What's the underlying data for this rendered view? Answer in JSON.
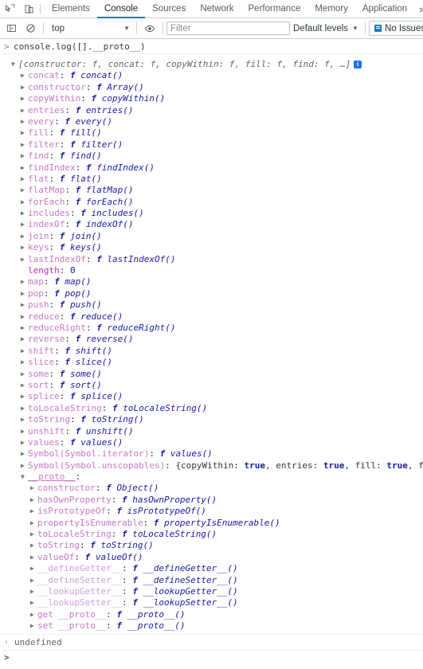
{
  "tabbar": {
    "icons": [
      {
        "name": "inspect-element-icon",
        "glyph": "inspect"
      },
      {
        "name": "device-toolbar-icon",
        "glyph": "device"
      }
    ],
    "tabs": [
      {
        "label": "Elements",
        "active": false
      },
      {
        "label": "Console",
        "active": true
      },
      {
        "label": "Sources",
        "active": false
      },
      {
        "label": "Network",
        "active": false
      },
      {
        "label": "Performance",
        "active": false
      },
      {
        "label": "Memory",
        "active": false
      },
      {
        "label": "Application",
        "active": false
      }
    ],
    "overflow_label": "»",
    "active_accent": "#1a73e8"
  },
  "toolbar": {
    "sidebar_toggle_name": "console-sidebar-toggle",
    "clear_console_name": "clear-console-icon",
    "context_value": "top",
    "context_caret": "▼",
    "eye_icon_name": "live-expression-eye-icon",
    "filter_placeholder": "Filter",
    "filter_value": "",
    "levels_label": "Default levels",
    "levels_caret": "▼",
    "issues_label": "No Issues",
    "issues_accent": "#1a73e8"
  },
  "console": {
    "command": "console.log([].__proto__)",
    "prompt_glyph": ">",
    "return_glyph": "‹",
    "return_value": "undefined",
    "preview_header": "[constructor: f, concat: f, copyWithin: f, fill: f, find: f, …]",
    "info_badge": "i"
  },
  "array_props": [
    {
      "name": "concat",
      "kind": "fn",
      "value": "concat()"
    },
    {
      "name": "constructor",
      "kind": "fn",
      "value": "Array()"
    },
    {
      "name": "copyWithin",
      "kind": "fn",
      "value": "copyWithin()"
    },
    {
      "name": "entries",
      "kind": "fn",
      "value": "entries()"
    },
    {
      "name": "every",
      "kind": "fn",
      "value": "every()"
    },
    {
      "name": "fill",
      "kind": "fn",
      "value": "fill()"
    },
    {
      "name": "filter",
      "kind": "fn",
      "value": "filter()"
    },
    {
      "name": "find",
      "kind": "fn",
      "value": "find()"
    },
    {
      "name": "findIndex",
      "kind": "fn",
      "value": "findIndex()"
    },
    {
      "name": "flat",
      "kind": "fn",
      "value": "flat()"
    },
    {
      "name": "flatMap",
      "kind": "fn",
      "value": "flatMap()"
    },
    {
      "name": "forEach",
      "kind": "fn",
      "value": "forEach()"
    },
    {
      "name": "includes",
      "kind": "fn",
      "value": "includes()"
    },
    {
      "name": "indexOf",
      "kind": "fn",
      "value": "indexOf()"
    },
    {
      "name": "join",
      "kind": "fn",
      "value": "join()"
    },
    {
      "name": "keys",
      "kind": "fn",
      "value": "keys()"
    },
    {
      "name": "lastIndexOf",
      "kind": "fn",
      "value": "lastIndexOf()"
    },
    {
      "name": "length",
      "kind": "num",
      "value": "0"
    },
    {
      "name": "map",
      "kind": "fn",
      "value": "map()"
    },
    {
      "name": "pop",
      "kind": "fn",
      "value": "pop()"
    },
    {
      "name": "push",
      "kind": "fn",
      "value": "push()"
    },
    {
      "name": "reduce",
      "kind": "fn",
      "value": "reduce()"
    },
    {
      "name": "reduceRight",
      "kind": "fn",
      "value": "reduceRight()"
    },
    {
      "name": "reverse",
      "kind": "fn",
      "value": "reverse()"
    },
    {
      "name": "shift",
      "kind": "fn",
      "value": "shift()"
    },
    {
      "name": "slice",
      "kind": "fn",
      "value": "slice()"
    },
    {
      "name": "some",
      "kind": "fn",
      "value": "some()"
    },
    {
      "name": "sort",
      "kind": "fn",
      "value": "sort()"
    },
    {
      "name": "splice",
      "kind": "fn",
      "value": "splice()"
    },
    {
      "name": "toLocaleString",
      "kind": "fn",
      "value": "toLocaleString()"
    },
    {
      "name": "toString",
      "kind": "fn",
      "value": "toString()"
    },
    {
      "name": "unshift",
      "kind": "fn",
      "value": "unshift()"
    },
    {
      "name": "values",
      "kind": "fn",
      "value": "values()"
    },
    {
      "name": "Symbol(Symbol.iterator)",
      "kind": "fn",
      "value": "values()"
    },
    {
      "name": "Symbol(Symbol.unscopables)",
      "kind": "obj",
      "value": "{copyWithin: true, entries: true, fill: true, find: true"
    }
  ],
  "proto_label": "__proto__",
  "object_props": [
    {
      "name": "constructor",
      "kind": "fn",
      "dim": false,
      "value": "Object()"
    },
    {
      "name": "hasOwnProperty",
      "kind": "fn",
      "dim": false,
      "value": "hasOwnProperty()"
    },
    {
      "name": "isPrototypeOf",
      "kind": "fn",
      "dim": false,
      "value": "isPrototypeOf()"
    },
    {
      "name": "propertyIsEnumerable",
      "kind": "fn",
      "dim": false,
      "value": "propertyIsEnumerable()"
    },
    {
      "name": "toLocaleString",
      "kind": "fn",
      "dim": false,
      "value": "toLocaleString()"
    },
    {
      "name": "toString",
      "kind": "fn",
      "dim": false,
      "value": "toString()"
    },
    {
      "name": "valueOf",
      "kind": "fn",
      "dim": false,
      "value": "valueOf()"
    },
    {
      "name": "__defineGetter__",
      "kind": "fn",
      "dim": true,
      "value": "__defineGetter__()"
    },
    {
      "name": "__defineSetter__",
      "kind": "fn",
      "dim": true,
      "value": "__defineSetter__()"
    },
    {
      "name": "__lookupGetter__",
      "kind": "fn",
      "dim": true,
      "value": "__lookupGetter__()"
    },
    {
      "name": "__lookupSetter__",
      "kind": "fn",
      "dim": true,
      "value": "__lookupSetter__()"
    },
    {
      "name": "get __proto__",
      "kind": "fn",
      "dim": false,
      "value": "__proto__()"
    },
    {
      "name": "set __proto__",
      "kind": "fn",
      "dim": false,
      "value": "__proto__()"
    }
  ]
}
